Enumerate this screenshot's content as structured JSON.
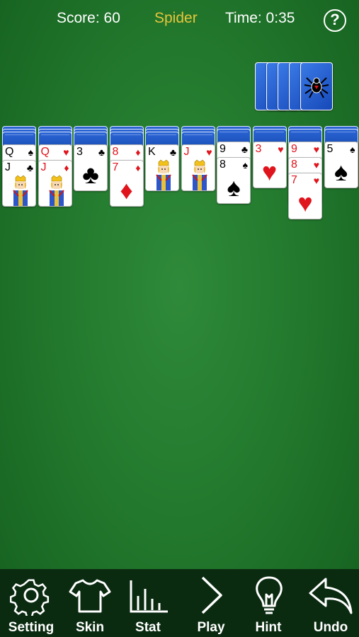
{
  "header": {
    "score": "Score: 60",
    "title": "Spider",
    "time": "Time: 0:35",
    "help_glyph": "?"
  },
  "stock": {
    "count": 5,
    "icon": "spider-icon"
  },
  "tableau": [
    {
      "backs": 3,
      "cards": [
        {
          "rank": "Q",
          "suit": "♠",
          "color": "black"
        },
        {
          "rank": "J",
          "suit": "♣",
          "color": "black",
          "face": "jack"
        }
      ]
    },
    {
      "backs": 3,
      "cards": [
        {
          "rank": "Q",
          "suit": "♥",
          "color": "red"
        },
        {
          "rank": "J",
          "suit": "♦",
          "color": "red",
          "face": "jack"
        }
      ]
    },
    {
      "backs": 3,
      "cards": [
        {
          "rank": "3",
          "suit": "♣",
          "color": "black",
          "center": true
        }
      ]
    },
    {
      "backs": 3,
      "cards": [
        {
          "rank": "8",
          "suit": "♦",
          "color": "red"
        },
        {
          "rank": "7",
          "suit": "♦",
          "color": "red",
          "center": true
        }
      ]
    },
    {
      "backs": 3,
      "cards": [
        {
          "rank": "K",
          "suit": "♣",
          "color": "black",
          "face": "king"
        }
      ]
    },
    {
      "backs": 3,
      "cards": [
        {
          "rank": "J",
          "suit": "♥",
          "color": "red",
          "face": "jack"
        }
      ]
    },
    {
      "backs": 2,
      "cards": [
        {
          "rank": "9",
          "suit": "♣",
          "color": "black"
        },
        {
          "rank": "8",
          "suit": "♠",
          "color": "black",
          "center": true
        }
      ]
    },
    {
      "backs": 2,
      "cards": [
        {
          "rank": "3",
          "suit": "♥",
          "color": "red",
          "center": true
        }
      ]
    },
    {
      "backs": 2,
      "cards": [
        {
          "rank": "9",
          "suit": "♥",
          "color": "red"
        },
        {
          "rank": "8",
          "suit": "♥",
          "color": "red"
        },
        {
          "rank": "7",
          "suit": "♥",
          "color": "red",
          "center": true
        }
      ]
    },
    {
      "backs": 2,
      "cards": [
        {
          "rank": "5",
          "suit": "♠",
          "color": "black",
          "center": true
        }
      ]
    }
  ],
  "toolbar": {
    "setting_label": "Setting",
    "skin_label": "Skin",
    "stat_label": "Stat",
    "play_label": "Play",
    "hint_label": "Hint",
    "undo_label": "Undo"
  },
  "colors": {
    "felt": "#237a2e",
    "title_accent": "#e8c53a",
    "card_back": "#1648b8",
    "toolbar_bg": "#0b2b11",
    "red_suit": "#e0141c"
  }
}
